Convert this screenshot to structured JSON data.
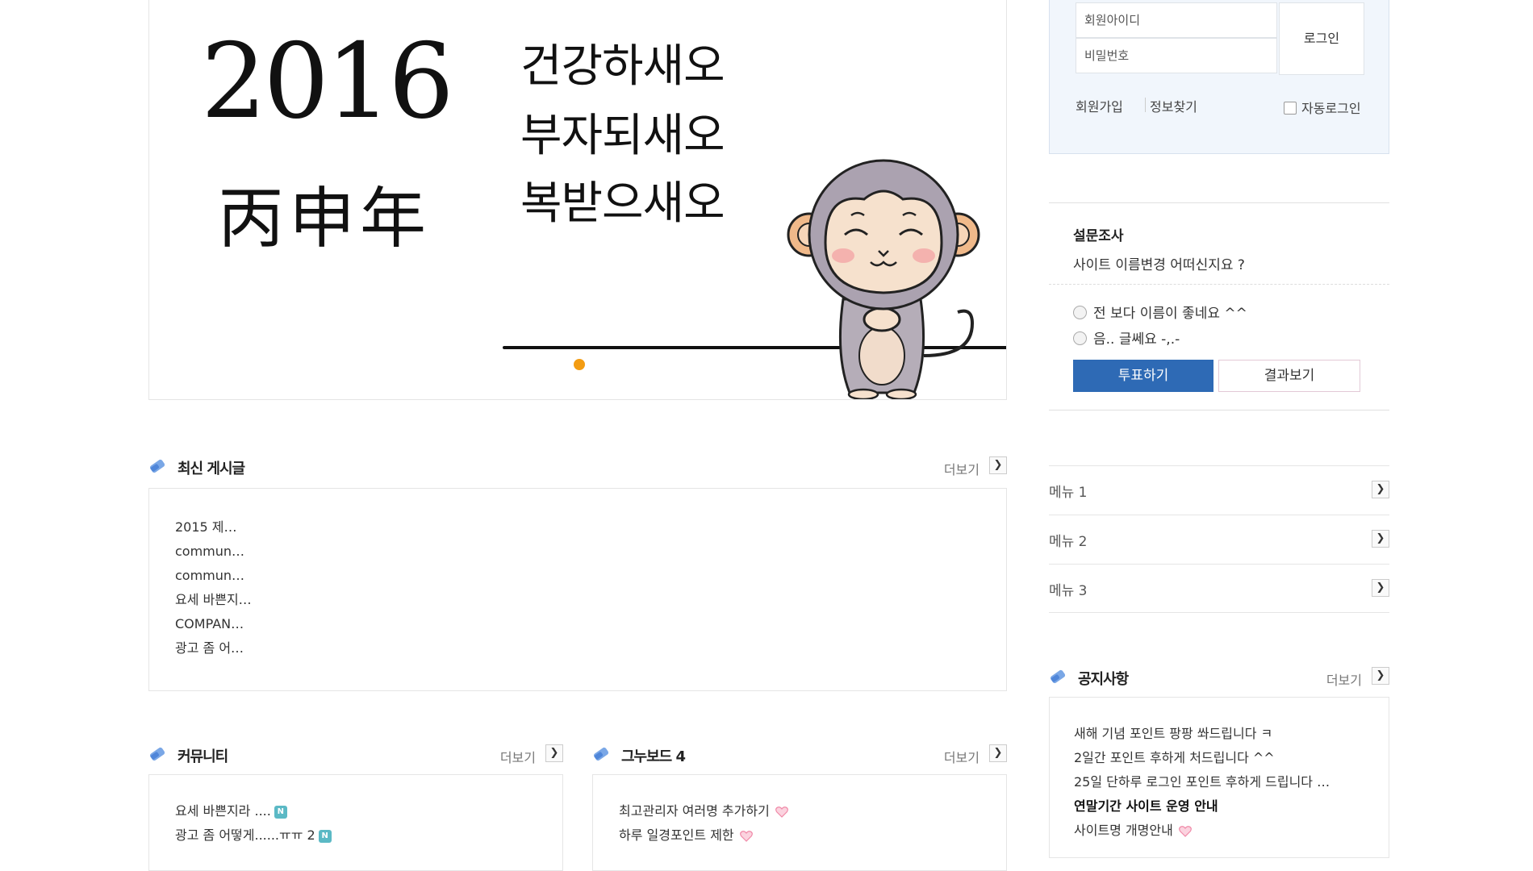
{
  "banner": {
    "year": "2016",
    "hanja": "丙申年",
    "wishes": [
      "건강하새오",
      "부자되새오",
      "복받으새오"
    ]
  },
  "more_label": "더보기",
  "latest": {
    "title": "최신 게시글",
    "items": [
      "2015 제…",
      "commun…",
      "commun…",
      "요세 바쁜지…",
      "COMPAN…",
      "광고 좀 어…"
    ]
  },
  "community": {
    "title": "커뮤니티",
    "items": [
      {
        "text": "요세 바쁜지라 ....",
        "badge": "N"
      },
      {
        "text": "광고 좀 어떻게......ㅠㅠ 2",
        "badge": "N"
      }
    ]
  },
  "board4": {
    "title": "그누보드 4",
    "items": [
      {
        "text": "최고관리자 여러명 추가하기",
        "icon": "heart-icon"
      },
      {
        "text": "하루 일경포인트 제한",
        "icon": "heart-icon"
      }
    ]
  },
  "login": {
    "id_placeholder": "회원아이디",
    "pw_placeholder": "비밀번호",
    "button": "로그인",
    "join": "회원가입",
    "find": "정보찾기",
    "auto": "자동로그인"
  },
  "poll": {
    "title": "설문조사",
    "question": "사이트 이름변경 어떠신지요 ?",
    "options": [
      "전 보다 이름이 좋네요 ^^",
      "음.. 글쎄요 -,.-"
    ],
    "vote": "투표하기",
    "result": "결과보기"
  },
  "side_menu": [
    "메뉴 1",
    "메뉴 2",
    "메뉴 3"
  ],
  "notice": {
    "title": "공지사항",
    "items": [
      {
        "text": "새해 기념 포인트 팡팡 쏴드립니다 ㅋ",
        "bold": false,
        "icon": ""
      },
      {
        "text": "2일간 포인트 후하게 처드립니다 ^^",
        "bold": false,
        "icon": ""
      },
      {
        "text": "25일 단하루 로그인 포인트 후하게 드립니다 …",
        "bold": false,
        "icon": ""
      },
      {
        "text": "연말기간 사이트 운영 안내",
        "bold": true,
        "icon": ""
      },
      {
        "text": "사이트명 개명안내",
        "bold": false,
        "icon": "heart-icon"
      }
    ]
  },
  "colors": {
    "accent_blue": "#2e6ab5",
    "login_bg": "#f1f6fc",
    "dot": "#f39c12",
    "badge": "#5bb9c5",
    "heart": "#f08aa8"
  }
}
